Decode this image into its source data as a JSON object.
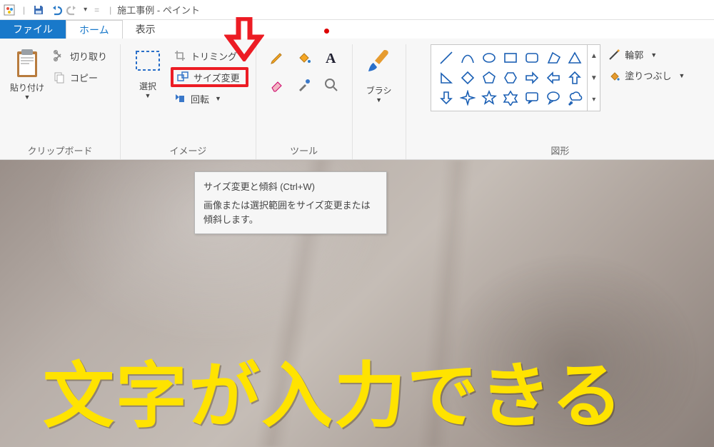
{
  "title": "施工事例 - ペイント",
  "tabs": {
    "file": "ファイル",
    "home": "ホーム",
    "view": "表示"
  },
  "groups": {
    "clipboard": {
      "label": "クリップボード",
      "paste": "貼り付け",
      "cut": "切り取り",
      "copy": "コピー"
    },
    "image": {
      "label": "イメージ",
      "select": "選択",
      "crop": "トリミング",
      "resize": "サイズ変更",
      "rotate": "回転"
    },
    "tools": {
      "label": "ツール"
    },
    "brush": {
      "label": "ブラシ"
    },
    "shapes": {
      "label": "図形",
      "outline": "輪郭",
      "fill": "塗りつぶし"
    }
  },
  "tooltip": {
    "title": "サイズ変更と傾斜 (Ctrl+W)",
    "body": "画像または選択範囲をサイズ変更または傾斜します。"
  },
  "canvas": {
    "overlay_text": "文字が入力できる"
  }
}
